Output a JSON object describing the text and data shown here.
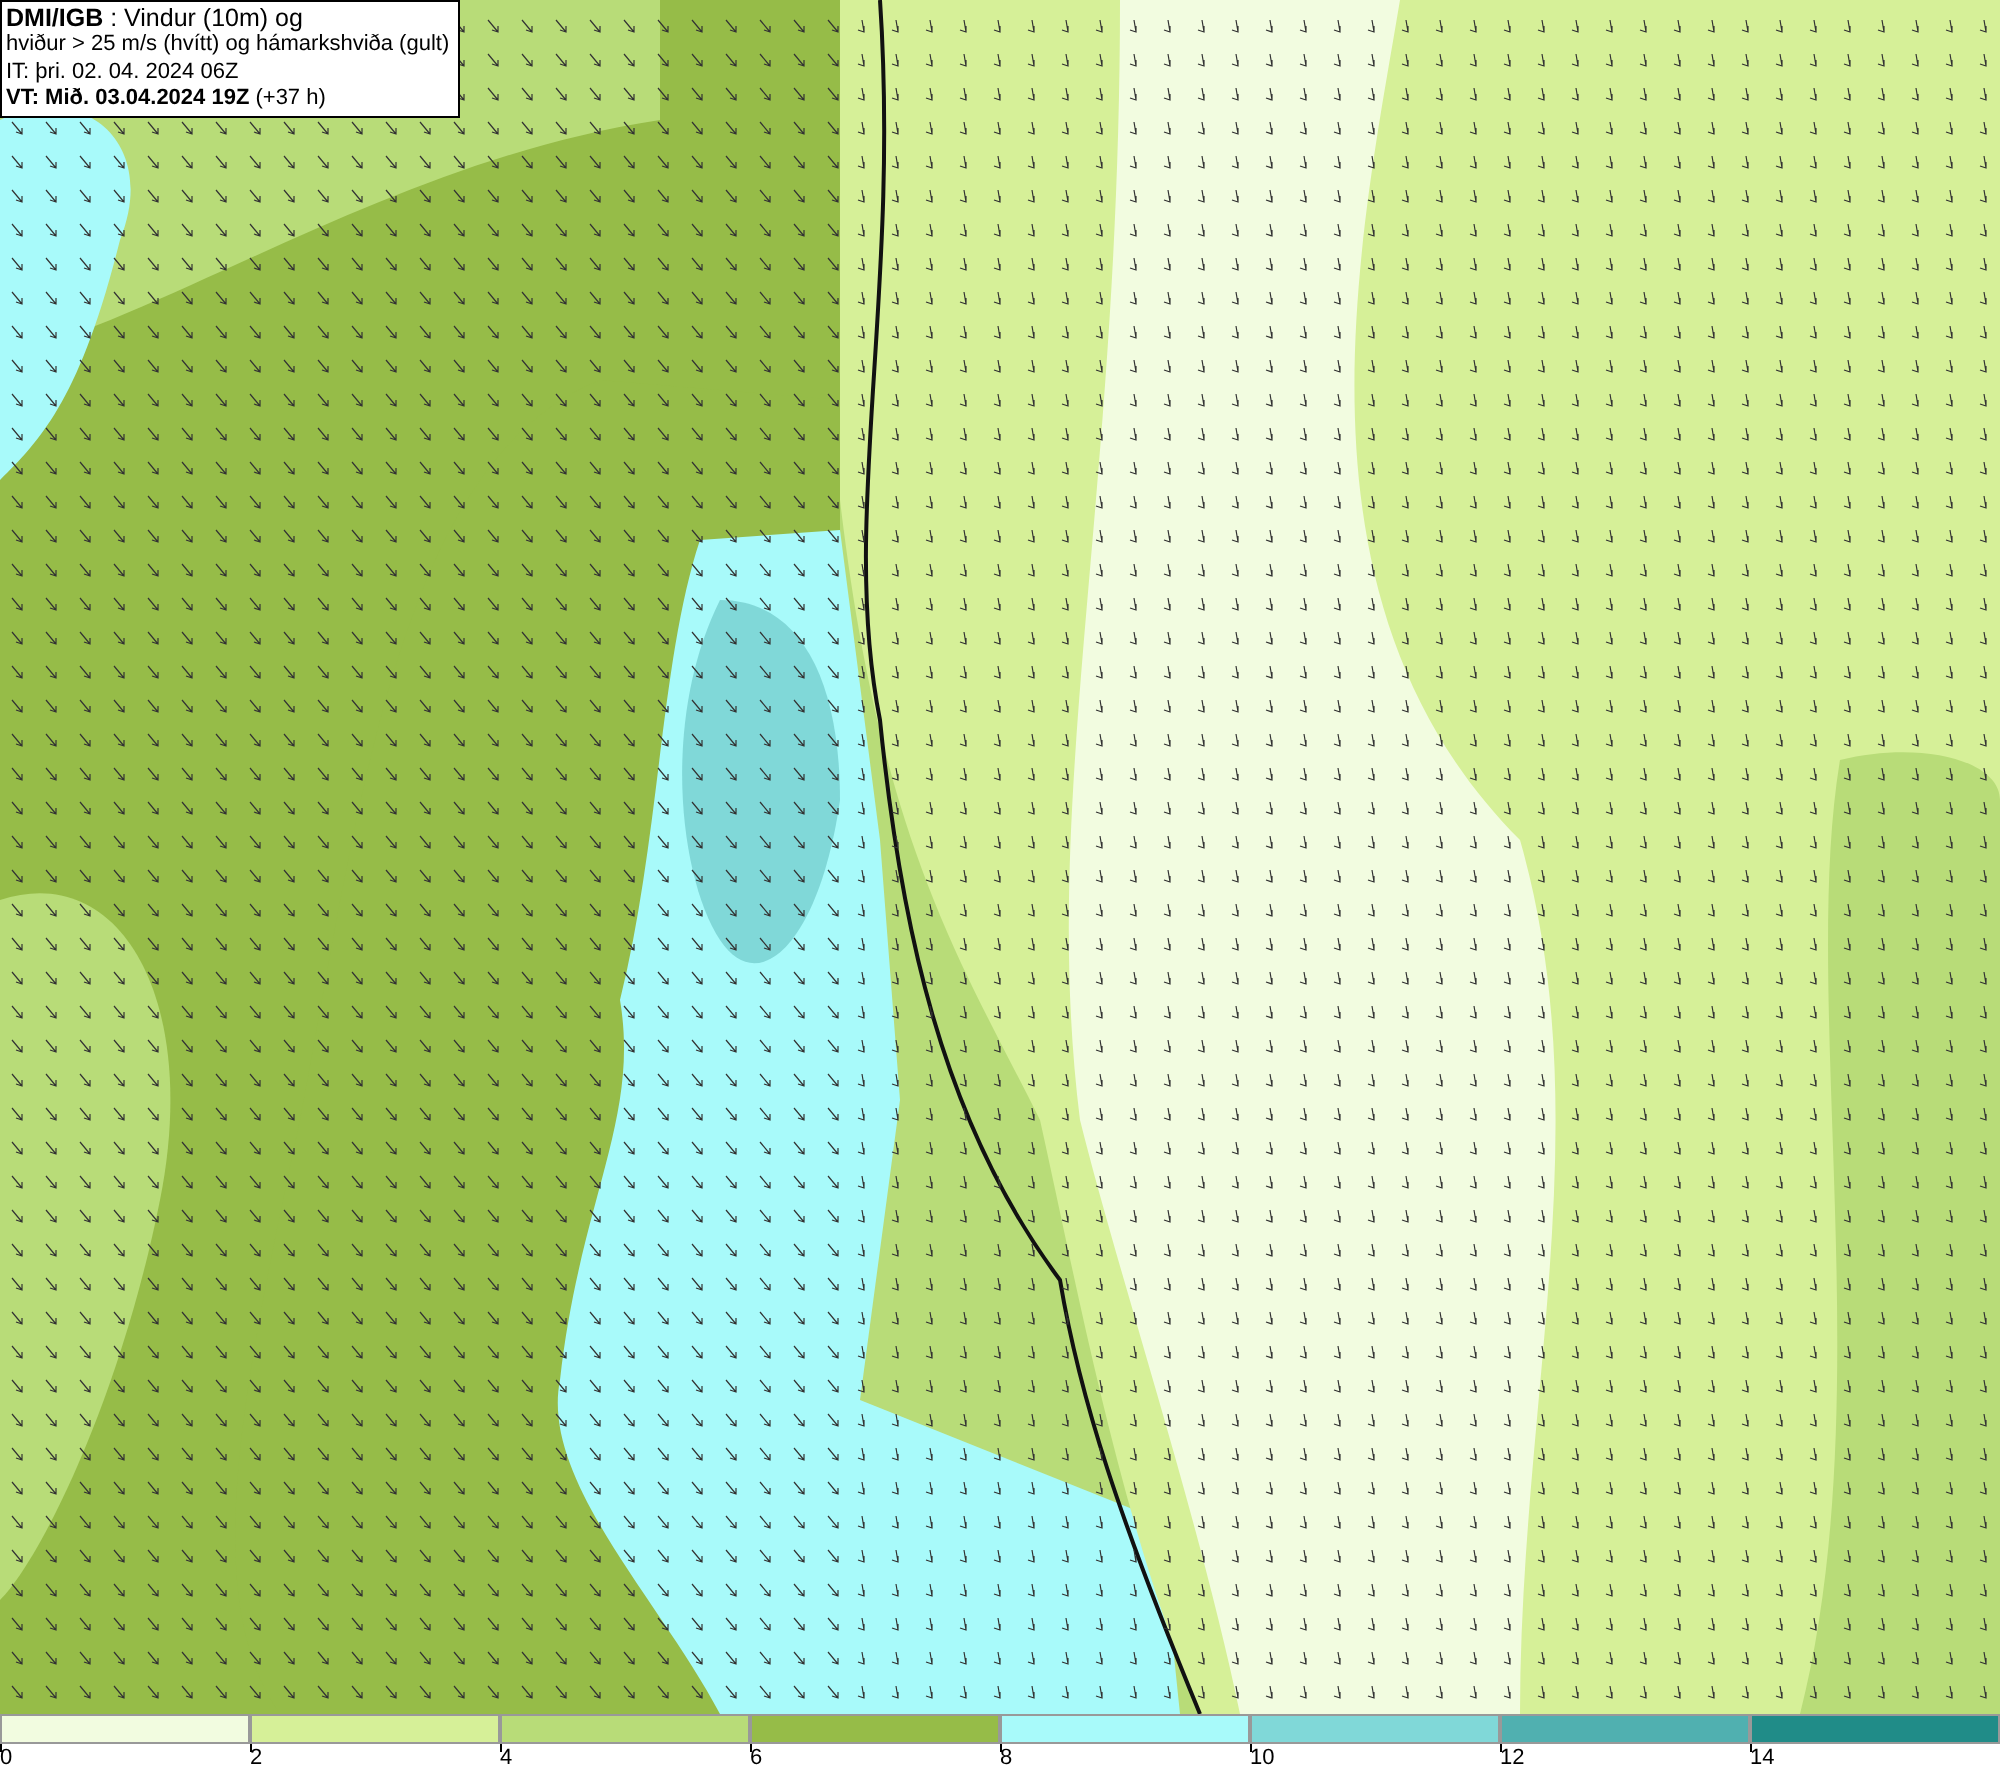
{
  "header": {
    "lines": [
      {
        "kind": "title",
        "text": "**DMI/IGB** : Vindur (10m) og"
      },
      {
        "kind": "plain",
        "text": "hviður > 25 m/s (hvítt) og hámarkshviða (gult)"
      },
      {
        "kind": "plain",
        "text": "IT: þri. 02. 04. 2024 06Z"
      },
      {
        "kind": "plain",
        "text": "**VT: Mið. 03.04.2024 19Z** (+37 h)"
      }
    ]
  },
  "legend": {
    "bins": [
      {
        "color": "#f2fce0"
      },
      {
        "color": "#d6f098"
      },
      {
        "color": "#b8dc78"
      },
      {
        "color": "#96bc48"
      },
      {
        "color": "#a8fafa"
      },
      {
        "color": "#80d8d8"
      },
      {
        "color": "#50b0b0"
      },
      {
        "color": "#208c88"
      }
    ],
    "ticks": [
      "0",
      "2",
      "4",
      "6",
      "8",
      "10",
      "12",
      "14"
    ]
  }
}
